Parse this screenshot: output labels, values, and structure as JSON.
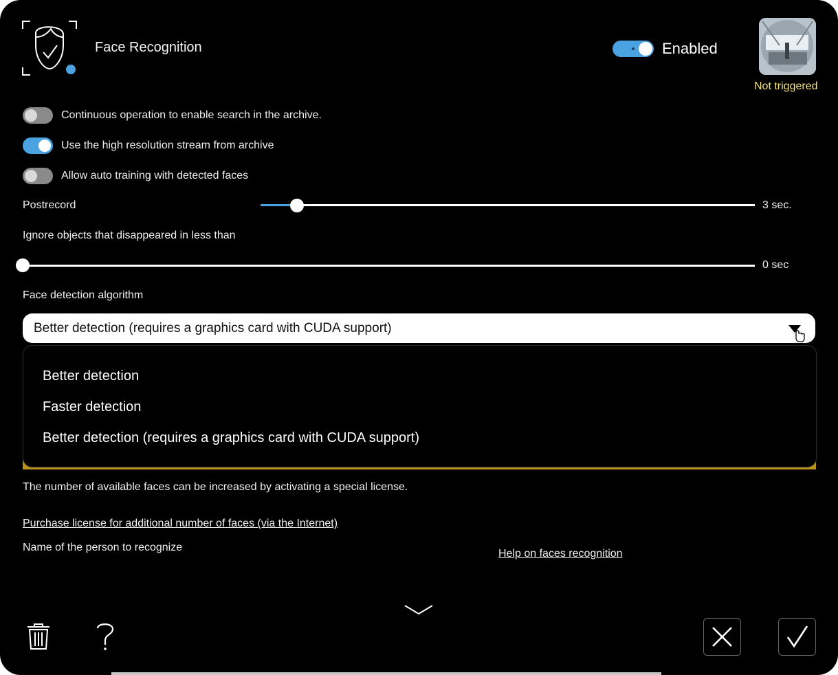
{
  "header": {
    "title": "Face Recognition",
    "enabled_label": "Enabled",
    "enabled": true,
    "status": "Not triggered",
    "icon": "face-recognition-icon",
    "camera_thumbnail": "camera-thumbnail"
  },
  "options": {
    "continuous": {
      "label": "Continuous operation to enable search in the archive.",
      "on": false
    },
    "high_res": {
      "label": "Use the high resolution stream from archive",
      "on": true
    },
    "auto_training": {
      "label": "Allow auto training with detected faces",
      "on": false
    }
  },
  "postrecord": {
    "label": "Postrecord",
    "value_text": "3 sec.",
    "fraction": 0.07
  },
  "ignore": {
    "label": "Ignore objects that disappeared in less than",
    "value_text": "0 sec",
    "fraction": 0.0
  },
  "algorithm": {
    "label": "Face detection algorithm",
    "selected": "Better detection (requires a graphics card with CUDA support)",
    "options": [
      "Better detection",
      "Faster detection",
      "Better detection (requires a graphics card with CUDA support)"
    ]
  },
  "license": {
    "note": "The number of available faces can be increased by activating a special license.",
    "purchase_link": "Purchase license for additional number of faces (via the Internet)"
  },
  "person": {
    "label": "Name of the person to recognize"
  },
  "help_link": "Help on faces recognition",
  "footer": {
    "delete_icon": "trash-icon",
    "help_icon": "question-icon",
    "expand_icon": "chevron-down-icon",
    "cancel_icon": "close-icon",
    "confirm_icon": "checkmark-icon"
  },
  "colors": {
    "accent": "#4aa3e0",
    "status": "#f4e27a",
    "warning_bar": "#b8901e",
    "background": "#000000"
  }
}
